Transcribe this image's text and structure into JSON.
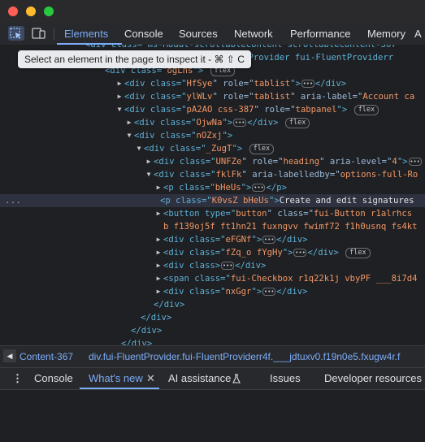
{
  "window": {
    "close_color": "#ff5f57",
    "minimize_color": "#febc2e",
    "zoom_color": "#28c840"
  },
  "toolbar": {
    "inspect_icon": "element-picker-icon",
    "device_icon": "device-toolbar-icon",
    "tabs": [
      {
        "label": "Elements",
        "active": true
      },
      {
        "label": "Console"
      },
      {
        "label": "Sources"
      },
      {
        "label": "Network"
      },
      {
        "label": "Performance"
      },
      {
        "label": "Memory"
      },
      {
        "label": "A"
      }
    ]
  },
  "tooltip": {
    "text": "Select an element in the page to inspect it - ⌘ ⇧ C"
  },
  "tree": {
    "l0": {
      "code": "<div class=\"ms-Modal-scrollableContent scrollableContent-367\""
    },
    "l1": {
      "code": "uentProvider fui-FluentProviderr"
    },
    "l2": {
      "open": "<div class=\"",
      "val": "ogLns",
      "close": "\">",
      "badge": "flex"
    },
    "l3": {
      "open": "<div class=\"",
      "val": "HfSye",
      "mid": "\" role=\"",
      "val2": "tablist",
      "close": "\">",
      "end": "</div>"
    },
    "l4": {
      "open": "<div class=\"",
      "val": "ylWLv",
      "mid": "\" role=\"",
      "val2": "tablist",
      "tail": "\" aria-label=\"",
      "val3": "Account ca"
    },
    "l5": {
      "open": "<div class=\"",
      "val": "pA2AO css-387",
      "mid": "\" role=\"",
      "val2": "tabpanel",
      "close": "\">",
      "badge": "flex"
    },
    "l6": {
      "open": "<div class=\"",
      "val": "OjwNa",
      "close": "\">",
      "end": "</div>",
      "badge": "flex"
    },
    "l7": {
      "open": "<div class=\"",
      "val": "nOZxj",
      "close": "\">"
    },
    "l8": {
      "open": "<div class=\"",
      "val": "_ZugT",
      "close": "\">",
      "badge": "flex"
    },
    "l9": {
      "open": "<div class=\"",
      "val": "UNFZe",
      "mid": "\" role=\"",
      "val2": "heading",
      "tail": "\" aria-level=\"",
      "val3": "4",
      "close": "\">"
    },
    "l10": {
      "open": "<div class=\"",
      "val": "fklFk",
      "tail": "\" aria-labelledby=\"",
      "val3": "options-full-Ro"
    },
    "l11": {
      "open": "<p class=\"",
      "val": "bHeUs",
      "close": "\">",
      "end": "</p>"
    },
    "l12": {
      "open": "<p class=\"",
      "val": "K0vsZ bHeUs",
      "close": "\">",
      "text": "Create and edit signatures",
      "gutter": "..."
    },
    "l13": {
      "open": "<button type=\"",
      "val": "button",
      "tail": "\" class=\"",
      "val3": "fui-Button r1alrhcs"
    },
    "l14": {
      "val": "b f139oj5f ft1hn21 fuxngvv fwimf72 f1h0usnq fs4kt"
    },
    "l15": {
      "open": "<div class=\"",
      "val": "eFGNf",
      "close": "\">",
      "end": "</div>"
    },
    "l16": {
      "open": "<div class=\"",
      "val": "fZq_o fYgHy",
      "close": "\">",
      "end": "</div>",
      "badge": "flex"
    },
    "l17": {
      "open": "<div class>",
      "end": "</div>"
    },
    "l18": {
      "open": "<span class=\"",
      "val": "fui-Checkbox r1q22k1j vbyPF ___8i7d4"
    },
    "l19": {
      "open": "<div class=\"",
      "val": "nxGgr",
      "close": "\">",
      "end": "</div>"
    },
    "l20": {
      "end": "</div>"
    },
    "l21": {
      "end": "</div>"
    },
    "l22": {
      "end": "</div>"
    },
    "l23": {
      "end": "</div>"
    }
  },
  "breadcrumbs": {
    "back": "◀",
    "first": "Content-367",
    "second": "div.fui-FluentProvider.fui-FluentProviderr4f.___jdtuxv0.f19n0e5.fxugw4r.f"
  },
  "drawer": {
    "menu_icon": "more-vertical-icon",
    "tabs": [
      {
        "label": "Console"
      },
      {
        "label": "What's new",
        "active": true,
        "close": "✕"
      },
      {
        "label": "AI assistance",
        "icon": "flask-icon"
      },
      {
        "label": "Issues"
      },
      {
        "label": "Developer resources"
      }
    ]
  }
}
